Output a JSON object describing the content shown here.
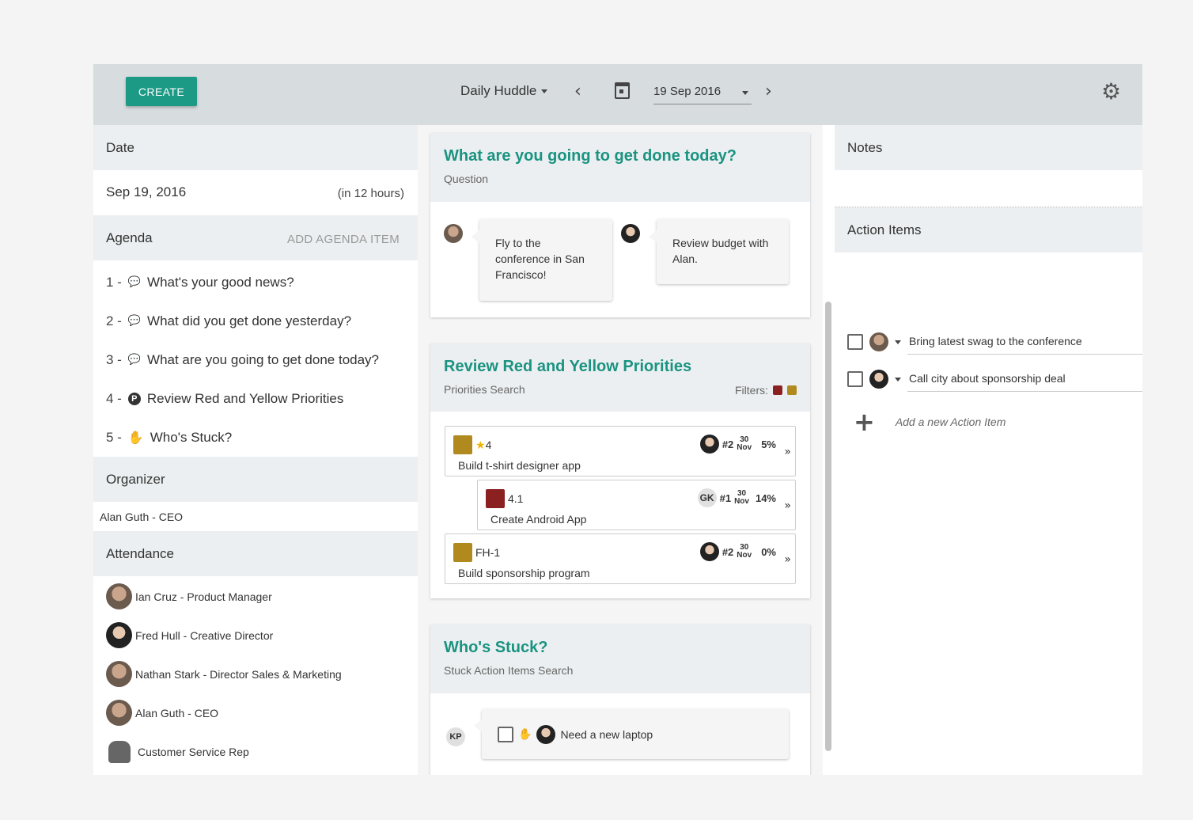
{
  "toolbar": {
    "create_label": "CREATE",
    "meeting_name": "Daily Huddle",
    "date_value": "19 Sep 2016"
  },
  "left": {
    "date_header": "Date",
    "date_value": "Sep 19, 2016",
    "date_relative": "(in 12 hours)",
    "agenda_header": "Agenda",
    "add_agenda_label": "ADD AGENDA ITEM",
    "agenda_items": [
      {
        "num": "1 -",
        "icon": "chat-icon",
        "label": "What's your good news?"
      },
      {
        "num": "2 -",
        "icon": "chat-icon",
        "label": "What did you get done yesterday?"
      },
      {
        "num": "3 -",
        "icon": "chat-icon",
        "label": "What are you going to get done today?"
      },
      {
        "num": "4 -",
        "icon": "priority-icon",
        "label": "Review Red and Yellow Priorities"
      },
      {
        "num": "5 -",
        "icon": "hand-icon",
        "label": "Who's Stuck?"
      }
    ],
    "organizer_header": "Organizer",
    "organizer_name": "Alan Guth - CEO",
    "attendance_header": "Attendance",
    "attendees": [
      "Ian Cruz - Product Manager",
      "Fred Hull - Creative Director",
      "Nathan Stark - Director Sales & Marketing",
      "Alan Guth - CEO",
      "Customer Service Rep"
    ]
  },
  "middle": {
    "question_card": {
      "title": "What are you going to get done today?",
      "subtitle": "Question",
      "answers": [
        "Fly to the conference in San Francisco!",
        "Review budget with Alan."
      ]
    },
    "priorities_card": {
      "title": "Review Red and Yellow Priorities",
      "subtitle": "Priorities Search",
      "filters_label": "Filters:",
      "filter_colors": [
        "#8b2020",
        "#b08a1e"
      ],
      "rows": [
        {
          "color": "#b08a1e",
          "id": "4",
          "star": true,
          "name": "Build t-shirt designer app",
          "rank": "#2",
          "day": "30",
          "month": "Nov",
          "pct": "5%",
          "owner": "avatar"
        },
        {
          "color": "#8b2020",
          "id": "4.1",
          "star": false,
          "name": "Create Android App",
          "rank": "#1",
          "day": "30",
          "month": "Nov",
          "pct": "14%",
          "owner": "GK"
        },
        {
          "color": "#b08a1e",
          "id": "FH-1",
          "star": false,
          "name": "Build sponsorship program",
          "rank": "#2",
          "day": "30",
          "month": "Nov",
          "pct": "0%",
          "owner": "avatar"
        }
      ]
    },
    "stuck_card": {
      "title": "Who's Stuck?",
      "subtitle": "Stuck Action Items Search",
      "initials": "KP",
      "item": "Need a new laptop"
    }
  },
  "right": {
    "notes_header": "Notes",
    "action_header": "Action Items",
    "action_items": [
      "Bring latest swag to the conference",
      "Call city about sponsorship deal"
    ],
    "add_placeholder": "Add a new Action Item"
  }
}
